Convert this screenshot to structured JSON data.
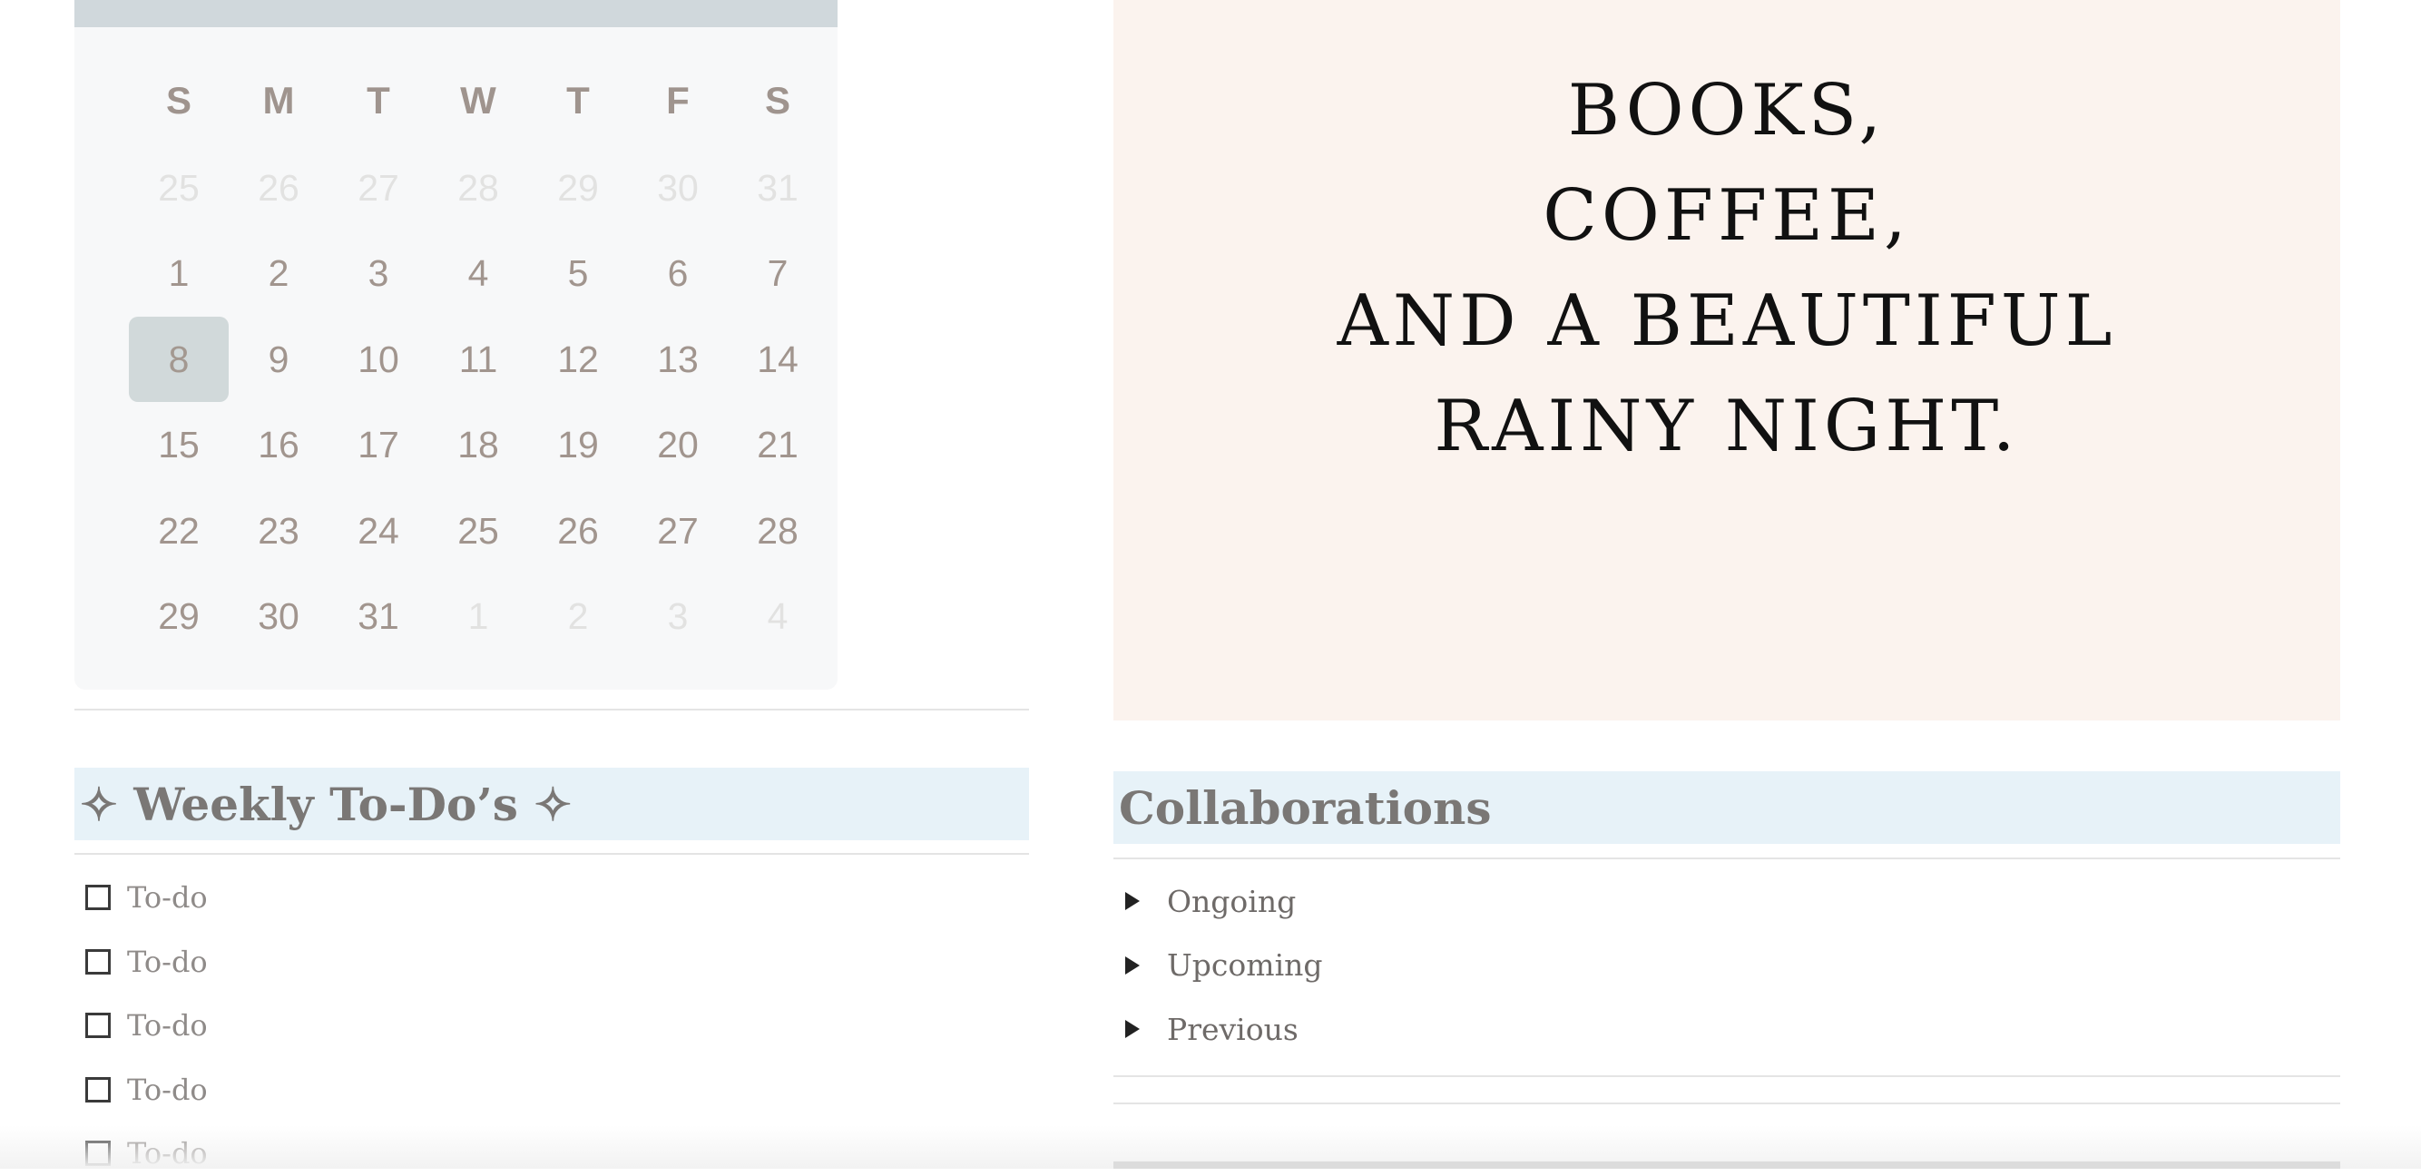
{
  "calendar": {
    "weekdays": [
      "S",
      "M",
      "T",
      "W",
      "T",
      "F",
      "S"
    ],
    "weeks": [
      [
        {
          "d": "25",
          "m": true
        },
        {
          "d": "26",
          "m": true
        },
        {
          "d": "27",
          "m": true
        },
        {
          "d": "28",
          "m": true
        },
        {
          "d": "29",
          "m": true
        },
        {
          "d": "30",
          "m": true
        },
        {
          "d": "31",
          "m": true
        }
      ],
      [
        {
          "d": "1"
        },
        {
          "d": "2"
        },
        {
          "d": "3"
        },
        {
          "d": "4"
        },
        {
          "d": "5"
        },
        {
          "d": "6"
        },
        {
          "d": "7"
        }
      ],
      [
        {
          "d": "8",
          "today": true
        },
        {
          "d": "9"
        },
        {
          "d": "10"
        },
        {
          "d": "11"
        },
        {
          "d": "12"
        },
        {
          "d": "13"
        },
        {
          "d": "14"
        }
      ],
      [
        {
          "d": "15"
        },
        {
          "d": "16"
        },
        {
          "d": "17"
        },
        {
          "d": "18"
        },
        {
          "d": "19"
        },
        {
          "d": "20"
        },
        {
          "d": "21"
        }
      ],
      [
        {
          "d": "22"
        },
        {
          "d": "23"
        },
        {
          "d": "24"
        },
        {
          "d": "25"
        },
        {
          "d": "26"
        },
        {
          "d": "27"
        },
        {
          "d": "28"
        }
      ],
      [
        {
          "d": "29"
        },
        {
          "d": "30"
        },
        {
          "d": "31"
        },
        {
          "d": "1",
          "m": true
        },
        {
          "d": "2",
          "m": true
        },
        {
          "d": "3",
          "m": true
        },
        {
          "d": "4",
          "m": true
        }
      ]
    ]
  },
  "quote": {
    "lines": [
      "BOOKS,",
      "COFFEE,",
      "AND A BEAUTIFUL",
      "RAINY NIGHT."
    ]
  },
  "weekly": {
    "title": "✧ Weekly To-Do’s ✧",
    "items": [
      "To-do",
      "To-do",
      "To-do",
      "To-do",
      "To-do"
    ]
  },
  "collaborations": {
    "title": "Collaborations",
    "toggles": [
      "Ongoing",
      "Upcoming",
      "Previous"
    ]
  },
  "colors": {
    "heading_bg": "#e7f2f8",
    "calendar_bg": "#f7f8f9",
    "today_bg": "#d1d9da",
    "quote_bg": "#fbf3ee"
  }
}
